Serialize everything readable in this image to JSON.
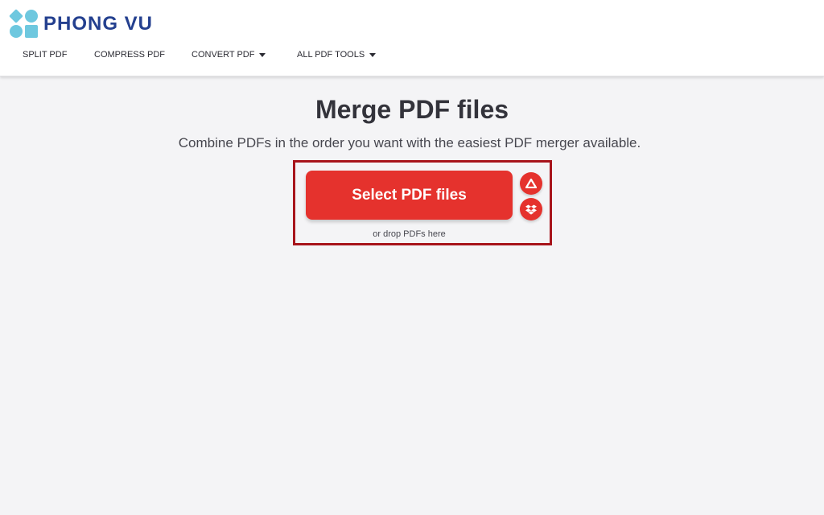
{
  "brand": {
    "name": "PHONG VU",
    "logo_color": "#6ec8df",
    "text_color": "#24408f"
  },
  "nav": {
    "items": [
      {
        "label": "SPLIT PDF",
        "has_dropdown": false
      },
      {
        "label": "COMPRESS PDF",
        "has_dropdown": false
      },
      {
        "label": "CONVERT PDF",
        "has_dropdown": true
      },
      {
        "label": "ALL PDF TOOLS",
        "has_dropdown": true
      }
    ]
  },
  "main": {
    "title": "Merge PDF files",
    "subtitle": "Combine PDFs in the order you want with the easiest PDF merger available.",
    "select_button_label": "Select PDF files",
    "drop_hint": "or drop PDFs here",
    "cloud_buttons": [
      {
        "icon": "google-drive-icon"
      },
      {
        "icon": "dropbox-icon"
      }
    ]
  },
  "colors": {
    "accent": "#e5322d",
    "highlight_border": "#a7141b",
    "background": "#f4f4f6"
  }
}
